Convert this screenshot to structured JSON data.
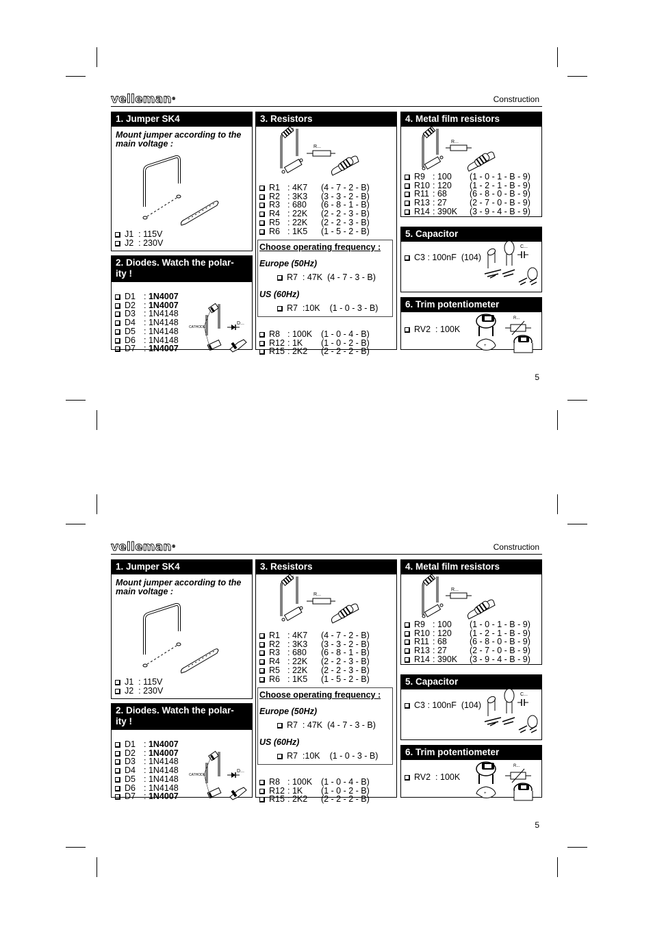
{
  "brand": {
    "logo_text": "velleman",
    "registered_mark": "®"
  },
  "pages": [
    {
      "section_title": "Construction",
      "page_number": "5"
    },
    {
      "section_title": "Construction",
      "page_number": "5"
    }
  ],
  "jumper": {
    "title": "1. Jumper SK4",
    "instruction": "Mount jumper according to the main voltage :",
    "items": [
      {
        "ref": "J1",
        "value": "115V"
      },
      {
        "ref": "J2",
        "value": "230V"
      }
    ]
  },
  "diodes": {
    "title": "2. Diodes. Watch the polar-ity !",
    "title_line1": "2. Diodes. Watch the polar-",
    "title_line2": "ity !",
    "cathode_label": "CATHODE",
    "symbol_label": "D...",
    "items": [
      {
        "ref": "D1",
        "value": "1N4007",
        "bold": true
      },
      {
        "ref": "D2",
        "value": "1N4007",
        "bold": true
      },
      {
        "ref": "D3",
        "value": "1N4148",
        "bold": false
      },
      {
        "ref": "D4",
        "value": "1N4148",
        "bold": false
      },
      {
        "ref": "D5",
        "value": "1N4148",
        "bold": false
      },
      {
        "ref": "D6",
        "value": "1N4148",
        "bold": false
      },
      {
        "ref": "D7",
        "value": "1N4007",
        "bold": true
      }
    ]
  },
  "resistors": {
    "title": "3. Resistors",
    "symbol_label": "R...",
    "items": [
      {
        "ref": "R1",
        "value": "4K7",
        "code": "(4 - 7 - 2 - B)"
      },
      {
        "ref": "R2",
        "value": "3K3",
        "code": "(3 - 3 - 2 - B)"
      },
      {
        "ref": "R3",
        "value": "680",
        "code": "(6 - 8 - 1 - B)"
      },
      {
        "ref": "R4",
        "value": "22K",
        "code": "(2 - 2 - 3 - B)"
      },
      {
        "ref": "R5",
        "value": "22K",
        "code": "(2 - 2 - 3 - B)"
      },
      {
        "ref": "R6",
        "value": "1K5",
        "code": "(1 - 5 - 2 - B)"
      }
    ],
    "frequency": {
      "title": "Choose operating frequency :",
      "europe_label": "Europe (50Hz)",
      "europe_item": {
        "ref": "R7",
        "value": "47K",
        "code": "(4 - 7 - 3 - B)"
      },
      "us_label": "US (60Hz)",
      "us_item": {
        "ref": "R7",
        "value": "10K",
        "code": "(1 - 0 - 3 - B)"
      }
    },
    "extra_items": [
      {
        "ref": "R8",
        "value": "100K",
        "code": "(1 - 0 - 4 - B)"
      },
      {
        "ref": "R12",
        "value": "1K",
        "code": "(1 - 0 - 2 - B)"
      },
      {
        "ref": "R15",
        "value": "2K2",
        "code": "(2 - 2 - 2 - B)"
      }
    ]
  },
  "metal_film": {
    "title": "4. Metal film resistors",
    "symbol_label": "R...",
    "items": [
      {
        "ref": "R9",
        "value": "100",
        "code": "(1 - 0 - 1 - B - 9)"
      },
      {
        "ref": "R10",
        "value": "120",
        "code": "(1 - 2 - 1 - B - 9)"
      },
      {
        "ref": "R11",
        "value": "68",
        "code": "(6 - 8 - 0 - B - 9)"
      },
      {
        "ref": "R13",
        "value": "27",
        "code": "(2 - 7 - 0 - B - 9)"
      },
      {
        "ref": "R14",
        "value": "390K",
        "code": "(3 - 9 - 4 - B - 9)"
      }
    ]
  },
  "capacitor": {
    "title": "5. Capacitor",
    "symbol_label": "C...",
    "items": [
      {
        "ref": "C3",
        "value": "100nF",
        "code": "(104)"
      }
    ]
  },
  "trimpot": {
    "title": "6. Trim potentiometer",
    "symbol_label": "R...",
    "items": [
      {
        "ref": "RV2",
        "value": "100K"
      }
    ]
  }
}
